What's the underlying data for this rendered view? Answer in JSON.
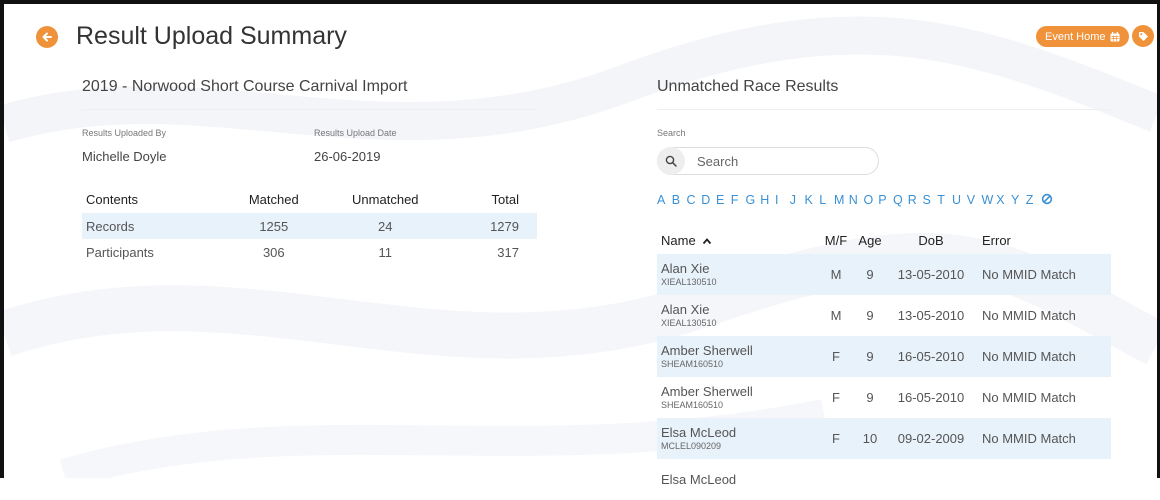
{
  "header": {
    "title": "Result Upload Summary",
    "event_home_label": "Event Home"
  },
  "import": {
    "title": "2019 - Norwood Short Course Carnival Import",
    "uploaded_by_label": "Results Uploaded By",
    "uploaded_by_value": "Michelle Doyle",
    "upload_date_label": "Results Upload Date",
    "upload_date_value": "26-06-2019"
  },
  "contents_table": {
    "headers": [
      "Contents",
      "Matched",
      "Unmatched",
      "Total"
    ],
    "rows": [
      [
        "Records",
        "1255",
        "24",
        "1279"
      ],
      [
        "Participants",
        "306",
        "11",
        "317"
      ]
    ]
  },
  "unmatched": {
    "title": "Unmatched Race Results",
    "search_label": "Search",
    "search_placeholder": "Search",
    "alphabet": [
      "A",
      "B",
      "C",
      "D",
      "E",
      "F",
      "G",
      "H",
      "I",
      "J",
      "K",
      "L",
      "M",
      "N",
      "O",
      "P",
      "Q",
      "R",
      "S",
      "T",
      "U",
      "V",
      "W",
      "X",
      "Y",
      "Z"
    ],
    "headers": [
      "Name",
      "M/F",
      "Age",
      "DoB",
      "Error"
    ],
    "rows": [
      {
        "name": "Alan Xie",
        "id": "XIEAL130510",
        "mf": "M",
        "age": "9",
        "dob": "13-05-2010",
        "error": "No MMID Match"
      },
      {
        "name": "Alan Xie",
        "id": "XIEAL130510",
        "mf": "M",
        "age": "9",
        "dob": "13-05-2010",
        "error": "No MMID Match"
      },
      {
        "name": "Amber Sherwell",
        "id": "SHEAM160510",
        "mf": "F",
        "age": "9",
        "dob": "16-05-2010",
        "error": "No MMID Match"
      },
      {
        "name": "Amber Sherwell",
        "id": "SHEAM160510",
        "mf": "F",
        "age": "9",
        "dob": "16-05-2010",
        "error": "No MMID Match"
      },
      {
        "name": "Elsa McLeod",
        "id": "MCLEL090209",
        "mf": "F",
        "age": "10",
        "dob": "09-02-2009",
        "error": "No MMID Match"
      },
      {
        "name": "Elsa McLeod",
        "id": "",
        "mf": "",
        "age": "",
        "dob": "",
        "error": ""
      }
    ]
  },
  "icons": {
    "back": "arrow-left-icon",
    "calendar": "calendar-icon",
    "tag": "tag-icon",
    "search": "search-icon",
    "sort": "chevron-up-icon",
    "clear": "clear-filter-icon"
  },
  "colors": {
    "accent": "#f0923a",
    "link": "#3a90d4",
    "row_shade": "#e8f2fb"
  }
}
